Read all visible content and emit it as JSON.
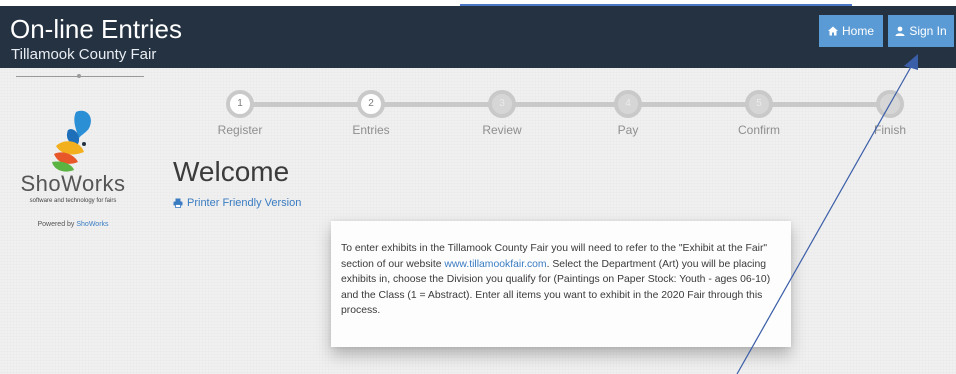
{
  "header": {
    "title": "On-line Entries",
    "subtitle": "Tillamook County Fair",
    "nav": {
      "home": "Home",
      "sign_in": "Sign In"
    }
  },
  "sidebar": {
    "brand": "ShoWorks",
    "brand_tagline": "software and technology for fairs",
    "powered_by_prefix": "Powered by",
    "powered_by_link": "ShoWorks"
  },
  "steps": [
    {
      "number": "1",
      "label": "Register"
    },
    {
      "number": "2",
      "label": "Entries"
    },
    {
      "number": "3",
      "label": "Review"
    },
    {
      "number": "4",
      "label": "Pay"
    },
    {
      "number": "5",
      "label": "Confirm"
    },
    {
      "number": "",
      "label": "Finish"
    }
  ],
  "main": {
    "heading": "Welcome",
    "printer_link": "Printer Friendly Version",
    "card": {
      "text_before": "To enter exhibits in the Tillamook County Fair you will need to refer to the \"Exhibit at the Fair\" section of our website ",
      "link": "www.tillamookfair.com",
      "text_after": ". Select the Department (Art) you will be placing exhibits in, choose the Division you qualify for (Paintings on Paper Stock: Youth - ages 06-10) and the Class (1 = Abstract).  Enter all items you want to exhibit in the 2020 Fair through this process."
    }
  },
  "colors": {
    "header_bg": "#243242",
    "nav_button": "#5b9bd5",
    "link": "#3a7cc2",
    "annotation": "#3b5ea8"
  }
}
